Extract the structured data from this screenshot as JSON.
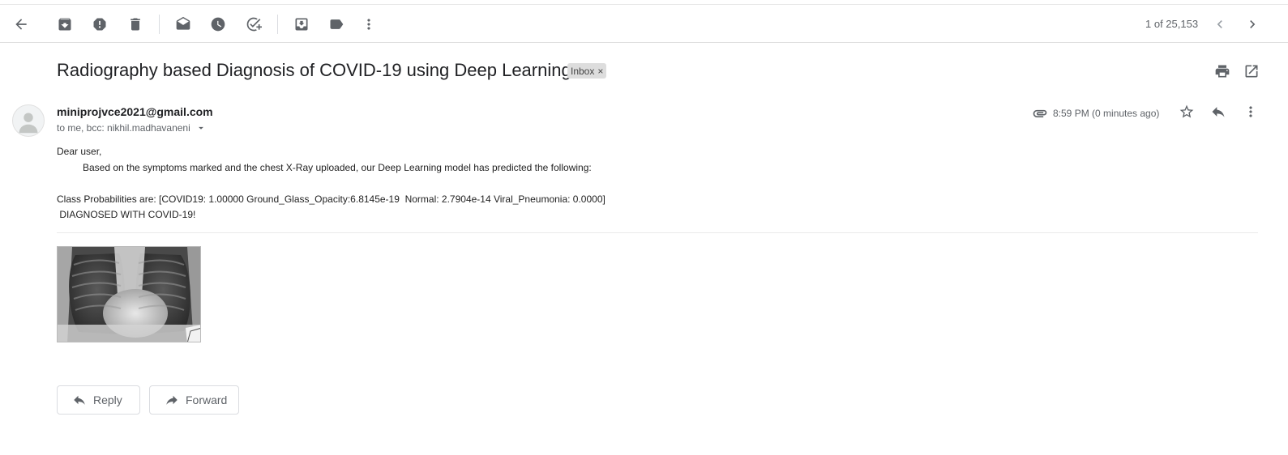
{
  "toolbar": {
    "icons": [
      "back-arrow-icon",
      "archive-icon",
      "report-spam-icon",
      "delete-icon",
      "mark-unread-icon",
      "snooze-icon",
      "add-to-tasks-icon",
      "move-to-icon",
      "labels-icon",
      "more-vert-icon"
    ],
    "pager": "1 of 25,153"
  },
  "email": {
    "subject": "Radiography based Diagnosis of COVID-19 using Deep Learning",
    "label": "Inbox",
    "sender": "miniprojvce2021@gmail.com",
    "recipients": "to me, bcc: nikhil.madhavaneni",
    "time": "8:59 PM (0 minutes ago)",
    "body": {
      "greeting": "Dear user,",
      "line1": "Based on the symptoms marked and the chest X-Ray uploaded, our Deep Learning model has predicted the following:",
      "line2": "Class Probabilities are: [COVID19: 1.00000 Ground_Glass_Opacity:6.8145e-19  Normal: 2.7904e-14 Viral_Pneumonia: 0.0000]",
      "line3": " DIAGNOSED WITH COVID-19!"
    }
  },
  "actions": {
    "reply": "Reply",
    "forward": "Forward"
  },
  "colors": {
    "icon": "#5f6368",
    "text": "#202124",
    "chip": "#dddddd"
  }
}
